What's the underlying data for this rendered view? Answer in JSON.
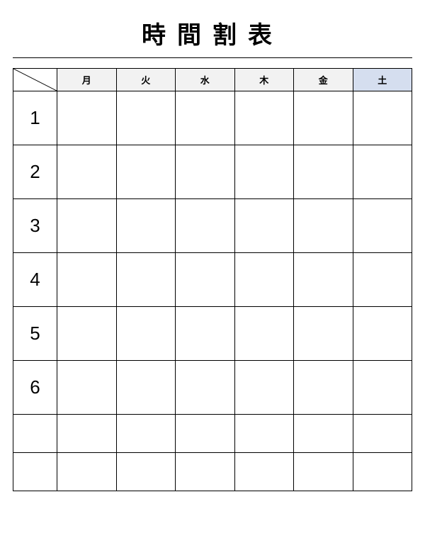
{
  "title": "時間割表",
  "days": [
    "月",
    "火",
    "水",
    "木",
    "金",
    "土"
  ],
  "periods": [
    "1",
    "2",
    "3",
    "4",
    "5",
    "6"
  ],
  "extraRows": [
    "",
    ""
  ],
  "cells": {}
}
